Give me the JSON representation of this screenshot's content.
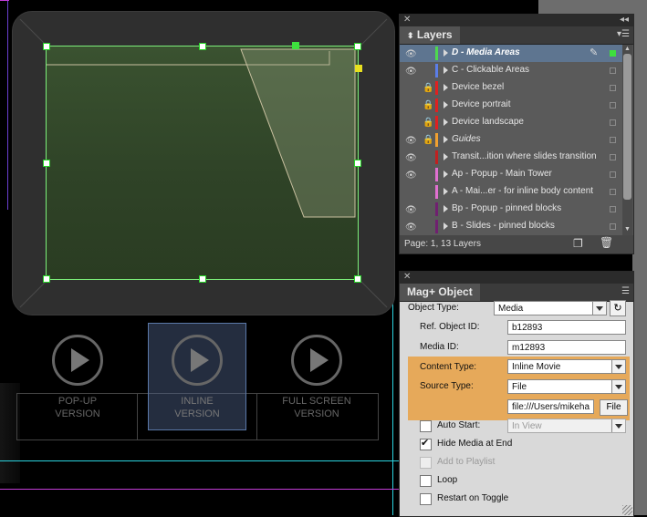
{
  "canvas": {
    "buttons": [
      {
        "label_line1": "POP-UP",
        "label_line2": "VERSION"
      },
      {
        "label_line1": "INLINE",
        "label_line2": "VERSION"
      },
      {
        "label_line1": "FULL SCREEN",
        "label_line2": "VERSION"
      }
    ]
  },
  "layers_panel": {
    "tab_label": "Layers",
    "layers": [
      {
        "name": "D - Media Areas",
        "color": "#4ed84e",
        "eye": true,
        "lock": false,
        "selected": true
      },
      {
        "name": "C - Clickable Areas",
        "color": "#5b7ee8",
        "eye": true,
        "lock": false
      },
      {
        "name": "Device bezel",
        "color": "#e02020",
        "eye": false,
        "lock": true
      },
      {
        "name": "Device portrait",
        "color": "#e02020",
        "eye": false,
        "lock": true
      },
      {
        "name": "Device landscape",
        "color": "#e02020",
        "eye": false,
        "lock": true
      },
      {
        "name": "Guides",
        "color": "#f0a030",
        "eye": true,
        "lock": true,
        "italic": true
      },
      {
        "name": "Transit...ition where slides transition",
        "color": "#c02020",
        "eye": true,
        "lock": false
      },
      {
        "name": "Ap - Popup - Main Tower",
        "color": "#e070d0",
        "eye": true,
        "lock": false
      },
      {
        "name": "A - Mai...er - for inline body content",
        "color": "#e070d0",
        "eye": false,
        "lock": false
      },
      {
        "name": "Bp - Popup - pinned blocks",
        "color": "#702070",
        "eye": true,
        "lock": false
      },
      {
        "name": "B - Slides - pinned blocks",
        "color": "#702070",
        "eye": true,
        "lock": false
      }
    ],
    "status": "Page: 1, 13 Layers"
  },
  "magplus_panel": {
    "tab_label": "Mag+ Object",
    "object_type_label": "Object Type:",
    "object_type_value": "Media",
    "ref_id_label": "Ref. Object ID:",
    "ref_id_value": "b12893",
    "media_id_label": "Media ID:",
    "media_id_value": "m12893",
    "content_type_label": "Content Type:",
    "content_type_value": "Inline Movie",
    "source_type_label": "Source Type:",
    "source_type_value": "File",
    "file_path_value": "file:///Users/mikeha",
    "file_button_label": "File",
    "auto_start_label": "Auto Start:",
    "auto_start_value": "In View",
    "hide_media_label": "Hide Media at End",
    "add_playlist_label": "Add to Playlist",
    "loop_label": "Loop",
    "restart_label": "Restart on Toggle"
  }
}
